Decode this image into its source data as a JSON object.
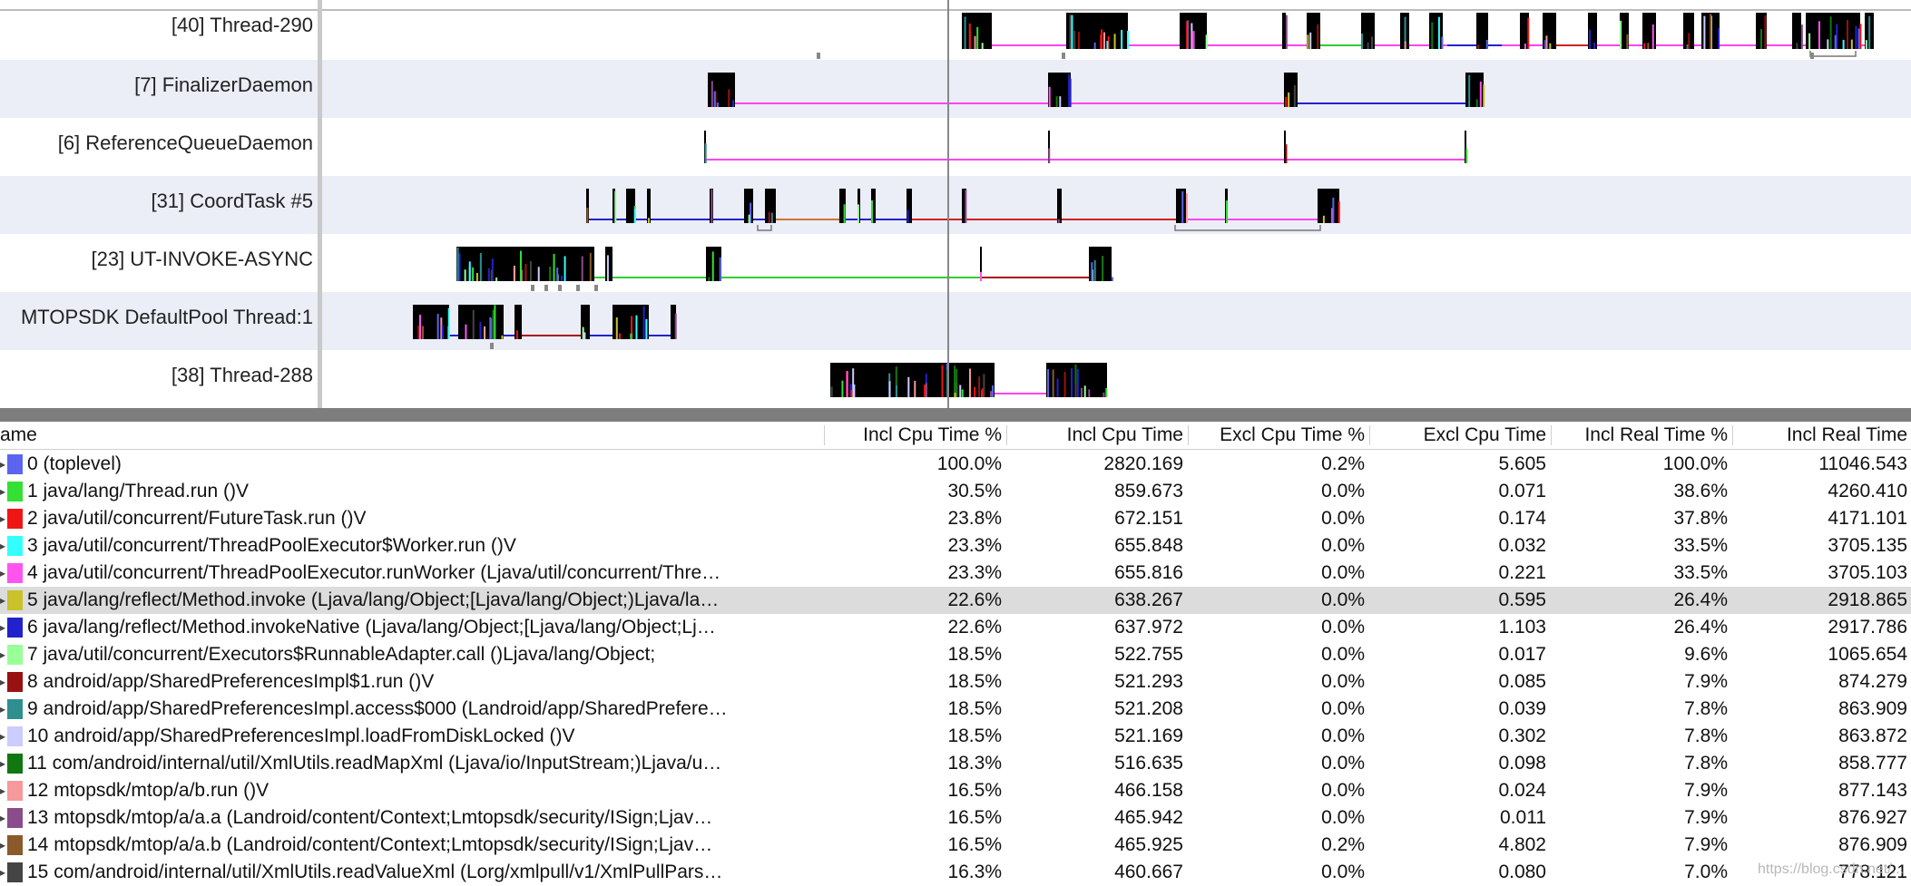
{
  "threads": [
    {
      "label": "[40] Thread-290"
    },
    {
      "label": "[7] FinalizerDaemon"
    },
    {
      "label": "[6] ReferenceQueueDaemon"
    },
    {
      "label": "[31] CoordTask #5"
    },
    {
      "label": "[23] UT-INVOKE-ASYNC"
    },
    {
      "label": "MTOPSDK DefaultPool Thread:1"
    },
    {
      "label": "[38] Thread-288"
    }
  ],
  "table": {
    "headers": [
      "ame",
      "Incl Cpu Time %",
      "Incl Cpu Time",
      "Excl Cpu Time %",
      "Excl Cpu Time",
      "Incl Real Time %",
      "Incl Real Time"
    ],
    "selected_index": 5,
    "rows": [
      {
        "name": "0 (toplevel)",
        "color": "#5b64ef",
        "incl_cpu_pct": "100.0%",
        "incl_cpu": "2820.169",
        "excl_cpu_pct": "0.2%",
        "excl_cpu": "5.605",
        "incl_real_pct": "100.0%",
        "incl_real": "11046.543"
      },
      {
        "name": "1 java/lang/Thread.run ()V",
        "color": "#33e033",
        "incl_cpu_pct": "30.5%",
        "incl_cpu": "859.673",
        "excl_cpu_pct": "0.0%",
        "excl_cpu": "0.071",
        "incl_real_pct": "38.6%",
        "incl_real": "4260.410"
      },
      {
        "name": "2 java/util/concurrent/FutureTask.run ()V",
        "color": "#f01515",
        "incl_cpu_pct": "23.8%",
        "incl_cpu": "672.151",
        "excl_cpu_pct": "0.0%",
        "excl_cpu": "0.174",
        "incl_real_pct": "37.8%",
        "incl_real": "4171.101"
      },
      {
        "name": "3 java/util/concurrent/ThreadPoolExecutor$Worker.run ()V",
        "color": "#33ffff",
        "incl_cpu_pct": "23.3%",
        "incl_cpu": "655.848",
        "excl_cpu_pct": "0.0%",
        "excl_cpu": "0.032",
        "incl_real_pct": "33.5%",
        "incl_real": "3705.135"
      },
      {
        "name": "4 java/util/concurrent/ThreadPoolExecutor.runWorker (Ljava/util/concurrent/Thre…",
        "color": "#ff55ee",
        "incl_cpu_pct": "23.3%",
        "incl_cpu": "655.816",
        "excl_cpu_pct": "0.0%",
        "excl_cpu": "0.221",
        "incl_real_pct": "33.5%",
        "incl_real": "3705.103"
      },
      {
        "name": "5 java/lang/reflect/Method.invoke (Ljava/lang/Object;[Ljava/lang/Object;)Ljava/la…",
        "color": "#c9c22a",
        "incl_cpu_pct": "22.6%",
        "incl_cpu": "638.267",
        "excl_cpu_pct": "0.0%",
        "excl_cpu": "0.595",
        "incl_real_pct": "26.4%",
        "incl_real": "2918.865"
      },
      {
        "name": "6 java/lang/reflect/Method.invokeNative (Ljava/lang/Object;[Ljava/lang/Object;Lj…",
        "color": "#2222cc",
        "incl_cpu_pct": "22.6%",
        "incl_cpu": "637.972",
        "excl_cpu_pct": "0.0%",
        "excl_cpu": "1.103",
        "incl_real_pct": "26.4%",
        "incl_real": "2917.786"
      },
      {
        "name": "7 java/util/concurrent/Executors$RunnableAdapter.call ()Ljava/lang/Object;",
        "color": "#99ff99",
        "incl_cpu_pct": "18.5%",
        "incl_cpu": "522.755",
        "excl_cpu_pct": "0.0%",
        "excl_cpu": "0.017",
        "incl_real_pct": "9.6%",
        "incl_real": "1065.654"
      },
      {
        "name": "8 android/app/SharedPreferencesImpl$1.run ()V",
        "color": "#991111",
        "incl_cpu_pct": "18.5%",
        "incl_cpu": "521.293",
        "excl_cpu_pct": "0.0%",
        "excl_cpu": "0.085",
        "incl_real_pct": "7.9%",
        "incl_real": "874.279"
      },
      {
        "name": "9 android/app/SharedPreferencesImpl.access$000 (Landroid/app/SharedPrefere…",
        "color": "#2f8f8f",
        "incl_cpu_pct": "18.5%",
        "incl_cpu": "521.208",
        "excl_cpu_pct": "0.0%",
        "excl_cpu": "0.039",
        "incl_real_pct": "7.8%",
        "incl_real": "863.909"
      },
      {
        "name": "10 android/app/SharedPreferencesImpl.loadFromDiskLocked ()V",
        "color": "#ccccff",
        "incl_cpu_pct": "18.5%",
        "incl_cpu": "521.169",
        "excl_cpu_pct": "0.0%",
        "excl_cpu": "0.302",
        "incl_real_pct": "7.8%",
        "incl_real": "863.872"
      },
      {
        "name": "11 com/android/internal/util/XmlUtils.readMapXml (Ljava/io/InputStream;)Ljava/u…",
        "color": "#117711",
        "incl_cpu_pct": "18.3%",
        "incl_cpu": "516.635",
        "excl_cpu_pct": "0.0%",
        "excl_cpu": "0.098",
        "incl_real_pct": "7.8%",
        "incl_real": "858.777"
      },
      {
        "name": "12 mtopsdk/mtop/a/b.run ()V",
        "color": "#f59a9a",
        "incl_cpu_pct": "16.5%",
        "incl_cpu": "466.158",
        "excl_cpu_pct": "0.0%",
        "excl_cpu": "0.024",
        "incl_real_pct": "7.9%",
        "incl_real": "877.143"
      },
      {
        "name": "13 mtopsdk/mtop/a/a.a (Landroid/content/Context;Lmtopsdk/security/ISign;Ljav…",
        "color": "#8a4c8a",
        "incl_cpu_pct": "16.5%",
        "incl_cpu": "465.942",
        "excl_cpu_pct": "0.0%",
        "excl_cpu": "0.011",
        "incl_real_pct": "7.9%",
        "incl_real": "876.927"
      },
      {
        "name": "14 mtopsdk/mtop/a/a.b (Landroid/content/Context;Lmtopsdk/security/ISign;Ljav…",
        "color": "#8b5a2b",
        "incl_cpu_pct": "16.5%",
        "incl_cpu": "465.925",
        "excl_cpu_pct": "0.2%",
        "excl_cpu": "4.802",
        "incl_real_pct": "7.9%",
        "incl_real": "876.909"
      },
      {
        "name": "15 com/android/internal/util/XmlUtils.readValueXml (Lorg/xmlpull/v1/XmlPullPars…",
        "color": "#444444",
        "incl_cpu_pct": "16.3%",
        "incl_cpu": "460.667",
        "excl_cpu_pct": "0.0%",
        "excl_cpu": "0.080",
        "incl_real_pct": "7.0%",
        "incl_real": "778.121"
      }
    ]
  },
  "watermark": "https://blog.csdn.net/..."
}
